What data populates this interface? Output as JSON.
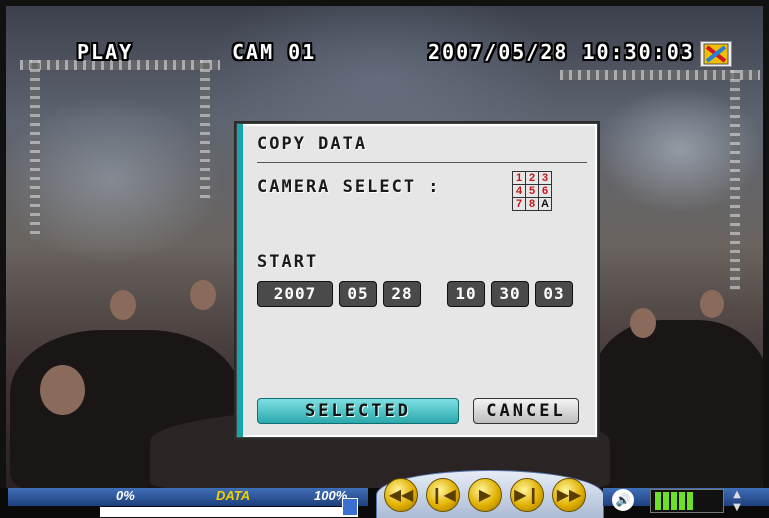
{
  "osd": {
    "mode": "PLAY",
    "camera": "CAM 01",
    "datetime": "2007/05/28 10:30:03"
  },
  "dialog": {
    "title": "COPY DATA",
    "camera_select_label": "CAMERA SELECT :",
    "camera_grid": [
      [
        "1",
        "2",
        "3"
      ],
      [
        "4",
        "5",
        "6"
      ],
      [
        "7",
        "8",
        "A"
      ]
    ],
    "start_label": "START",
    "start": {
      "year": "2007",
      "month": "05",
      "day": "28",
      "hour": "10",
      "minute": "30",
      "second": "03"
    },
    "selected_button": "SELECTED",
    "cancel_button": "CANCEL"
  },
  "bottom_bar": {
    "progress_start": "0%",
    "progress_label": "DATA",
    "progress_end": "100%",
    "progress_value": 1.0,
    "playback_controls": [
      "fast-rewind-icon",
      "step-back-icon",
      "play-icon",
      "step-forward-icon",
      "fast-forward-icon"
    ],
    "volume_level_bars": 5,
    "colors": {
      "accent": "#1aa3a8",
      "bar_blue": "#2b559b",
      "control_gold": "#e1b000",
      "volume_green": "#6fe02a",
      "camera_number_red": "#c41818"
    }
  }
}
